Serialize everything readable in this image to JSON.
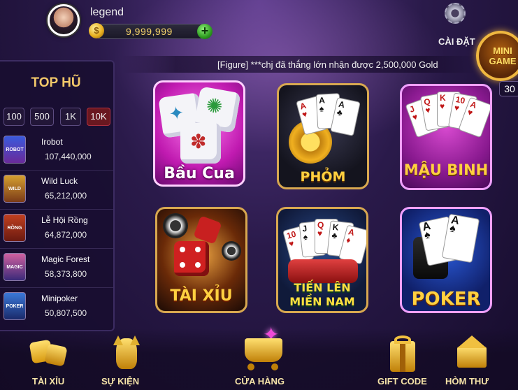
{
  "header": {
    "username": "legend",
    "gold": "9,999,999",
    "settings_label": "CÀI ĐẶT",
    "minigame_label": "MINI GAME",
    "minigame_count": "30"
  },
  "ticker": {
    "text": "[Figure] ***chj đã thắng lớn nhận được 2,500,000 Gold"
  },
  "jackpot": {
    "title": "TOP HŨ",
    "filters": [
      "100",
      "500",
      "1K",
      "10K"
    ],
    "active_filter": "10K",
    "items": [
      {
        "name": "Irobot",
        "value": "107,440,000"
      },
      {
        "name": "Wild Luck",
        "value": "65,212,000"
      },
      {
        "name": "Lễ Hội Rồng",
        "value": "64,872,000"
      },
      {
        "name": "Magic Forest",
        "value": "58,373,800"
      },
      {
        "name": "Minipoker",
        "value": "50,807,500"
      }
    ]
  },
  "games": [
    {
      "label": "Bầu Cua"
    },
    {
      "label": "PHỎM"
    },
    {
      "label": "MẬU BINH"
    },
    {
      "label": "TÀI XỈU"
    },
    {
      "label_line1": "TIẾN LÊN",
      "label_line2": "MIỀN NAM"
    },
    {
      "label": "POKER"
    }
  ],
  "bottom_nav": {
    "taixiu": "TÀI XỈU",
    "sukien": "SỰ KIỆN",
    "cuahang": "CỬA HÀNG",
    "giftcode": "GIFT CODE",
    "homthu": "HÒM THƯ"
  },
  "colors": {
    "background": "#2a1a4a",
    "gold_text": "#f7d56a",
    "accent_pink": "#e83ad0",
    "accent_gold": "#f0b840"
  }
}
